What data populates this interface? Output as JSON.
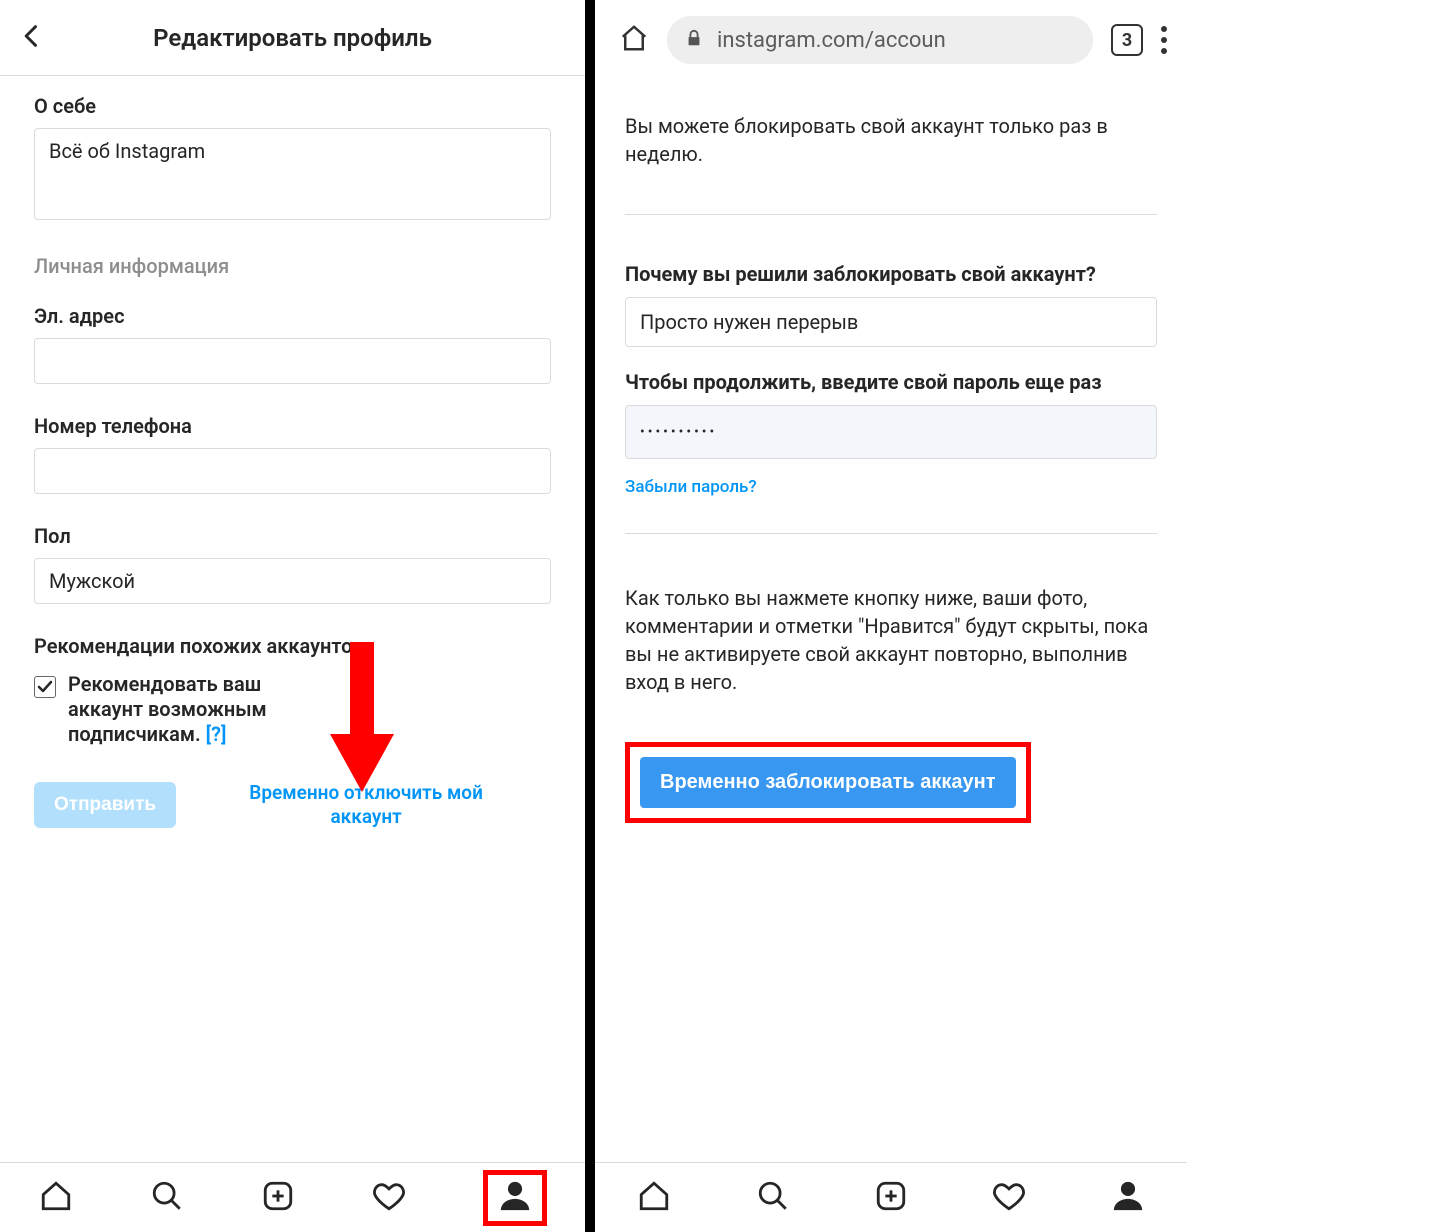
{
  "left": {
    "title": "Редактировать профиль",
    "about_label": "О себе",
    "about_value": "Всё об Instagram",
    "personal_info": "Личная информация",
    "email_label": "Эл. адрес",
    "email_value": "",
    "phone_label": "Номер телефона",
    "phone_value": "",
    "gender_label": "Пол",
    "gender_value": "Мужской",
    "recommend_heading": "Рекомендации похожих аккаунтов",
    "recommend_text": "Рекомендовать ваш аккаунт возможным подписчикам.",
    "help_link": "[?]",
    "submit_label": "Отправить",
    "disable_link": "Временно отключить мой аккаунт"
  },
  "right": {
    "url": "instagram.com/accoun",
    "tab_count": "3",
    "info_top": "Вы можете блокировать свой аккаунт только раз в неделю.",
    "reason_label": "Почему вы решили заблокировать свой аккаунт?",
    "reason_value": "Просто нужен перерыв",
    "password_label": "Чтобы продолжить, введите свой пароль еще раз",
    "password_value": "••••••••••",
    "forgot": "Забыли пароль?",
    "confirm_info": "Как только вы нажмете кнопку ниже, ваши фото, комментарии и отметки \"Нравится\" будут скрыты, пока вы не активируете свой аккаунт повторно, выполнив вход в него.",
    "disable_btn": "Временно заблокировать аккаунт"
  }
}
